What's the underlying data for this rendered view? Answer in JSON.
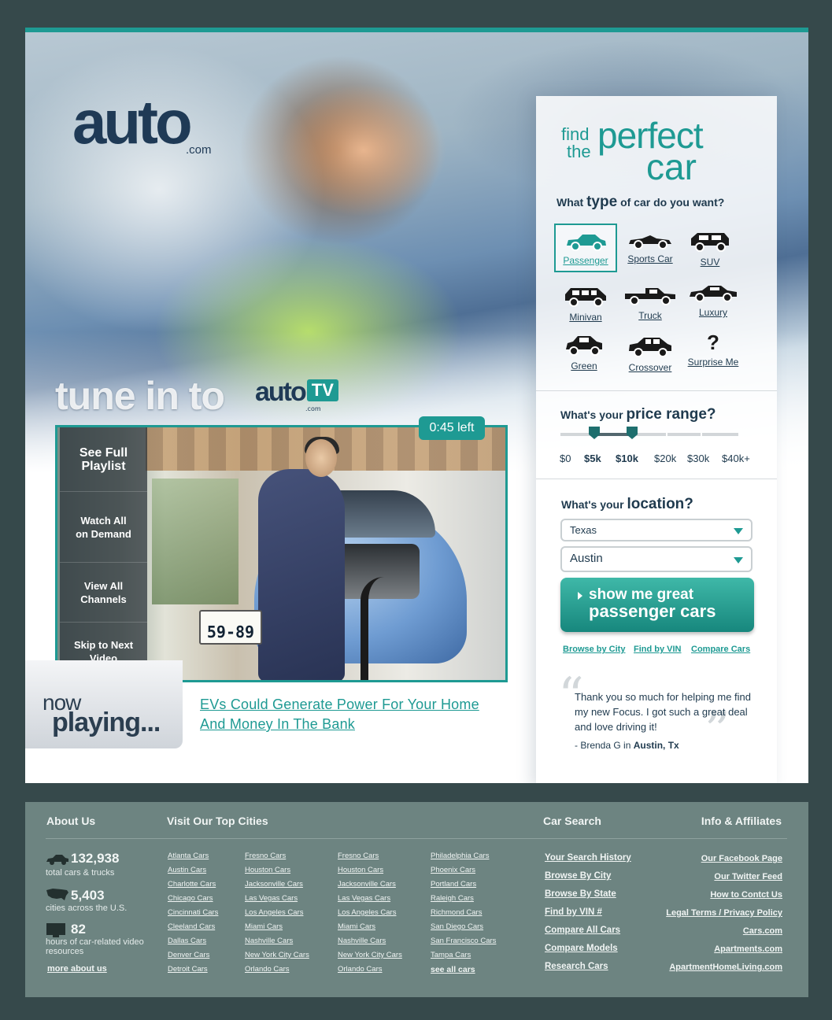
{
  "brand": {
    "logo_text": "auto",
    "logo_suffix": ".com"
  },
  "tv": {
    "heading": "tune in to",
    "logo_text": "auto",
    "logo_tv": "TV",
    "logo_suffix": ".com",
    "timer": "0:45 left"
  },
  "video": {
    "menu": [
      {
        "label": "See Full Playlist"
      },
      {
        "label": "Watch All on Demand"
      },
      {
        "label": "View All Channels"
      },
      {
        "label": "Skip to Next Video"
      }
    ],
    "plate": "59-89"
  },
  "now_playing": {
    "line1": "now",
    "line2": "playing...",
    "title": "EVs Could Generate Power For Your Home And Money In The Bank"
  },
  "finder": {
    "title_find": "find",
    "title_the": "the",
    "title_perfect": "perfect",
    "title_car": "car",
    "type_q_pre": "What",
    "type_q_strong": "type",
    "type_q_post": "of car do you want?",
    "types": [
      {
        "label": "Passenger",
        "icon": "sedan-icon",
        "selected": true
      },
      {
        "label": "Sports Car",
        "icon": "sports-car-icon"
      },
      {
        "label": "SUV",
        "icon": "suv-icon"
      },
      {
        "label": "Minivan",
        "icon": "minivan-icon"
      },
      {
        "label": "Truck",
        "icon": "truck-icon"
      },
      {
        "label": "Luxury",
        "icon": "luxury-car-icon"
      },
      {
        "label": "Green",
        "icon": "green-car-icon"
      },
      {
        "label": "Crossover",
        "icon": "crossover-icon"
      },
      {
        "label": "Surprise Me",
        "icon": "question-mark-icon"
      }
    ],
    "price_q_pre": "What's your",
    "price_q_strong": "price range",
    "price_q_post": "?",
    "price_labels": [
      "$0",
      "$5k",
      "$10k",
      "$20k",
      "$30k",
      "$40k+"
    ],
    "price_min": "$5k",
    "price_max": "$10k",
    "loc_q_pre": "What's your",
    "loc_q_strong": "location",
    "loc_q_post": "?",
    "state": "Texas",
    "city": "Austin",
    "button_line1": "show me great",
    "button_line2": "passenger cars",
    "links": [
      "Browse by City",
      "Find by VIN",
      "Compare Cars"
    ],
    "testimonial": "Thank you so much for helping me find my new Focus. I got such a great deal and love driving it!",
    "testimonial_by_pre": "- Brenda G in",
    "testimonial_by_place": "Austin, Tx",
    "accent_color": "#1e9a93"
  },
  "footer": {
    "about_heading": "About Us",
    "cities_heading": "Visit Our Top Cities",
    "search_heading": "Car Search",
    "info_heading": "Info & Affiliates",
    "stats": [
      {
        "num": "132,938",
        "label": "total cars & trucks",
        "icon": "car-icon"
      },
      {
        "num": "5,403",
        "label": "cities across the U.S.",
        "icon": "us-map-icon"
      },
      {
        "num": "82",
        "label": "hours of car-related video resources",
        "icon": "tv-icon"
      }
    ],
    "more_about": "more about us",
    "cities_col1": [
      "Atlanta Cars",
      "Austin Cars",
      "Charlotte Cars",
      "Chicago Cars",
      "Cincinnati Cars",
      "Cleeland Cars",
      "Dallas Cars",
      "Denver Cars",
      "Detroit Cars"
    ],
    "cities_col2": [
      "Fresno Cars",
      "Houston Cars",
      "Jacksonville Cars",
      "Las Vegas Cars",
      "Los Angeles Cars",
      "Miami Cars",
      "Nashville Cars",
      "New York City Cars",
      "Orlando Cars"
    ],
    "cities_col3": [
      "Fresno Cars",
      "Houston Cars",
      "Jacksonville Cars",
      "Las Vegas Cars",
      "Los Angeles Cars",
      "Miami Cars",
      "Nashville Cars",
      "New York City Cars",
      "Orlando Cars"
    ],
    "cities_col4": [
      "Philadelphia Cars",
      "Phoenix Cars",
      "Portland Cars",
      "Raleigh Cars",
      "Richmond Cars",
      "San Diego Cars",
      "San Francisco Cars",
      "Tampa Cars",
      "see all cars"
    ],
    "search_links": [
      "Your Search History",
      "Browse By City",
      "Browse By State",
      "Find by VIN #",
      "Compare All Cars",
      "Compare Models",
      "Research Cars"
    ],
    "info_links": [
      "Our Facebook Page",
      "Our Twitter Feed",
      "How to Contct Us",
      "Legal Terms / Privacy Policy",
      "Cars.com",
      "Apartments.com",
      "ApartmentHomeLiving.com"
    ]
  }
}
